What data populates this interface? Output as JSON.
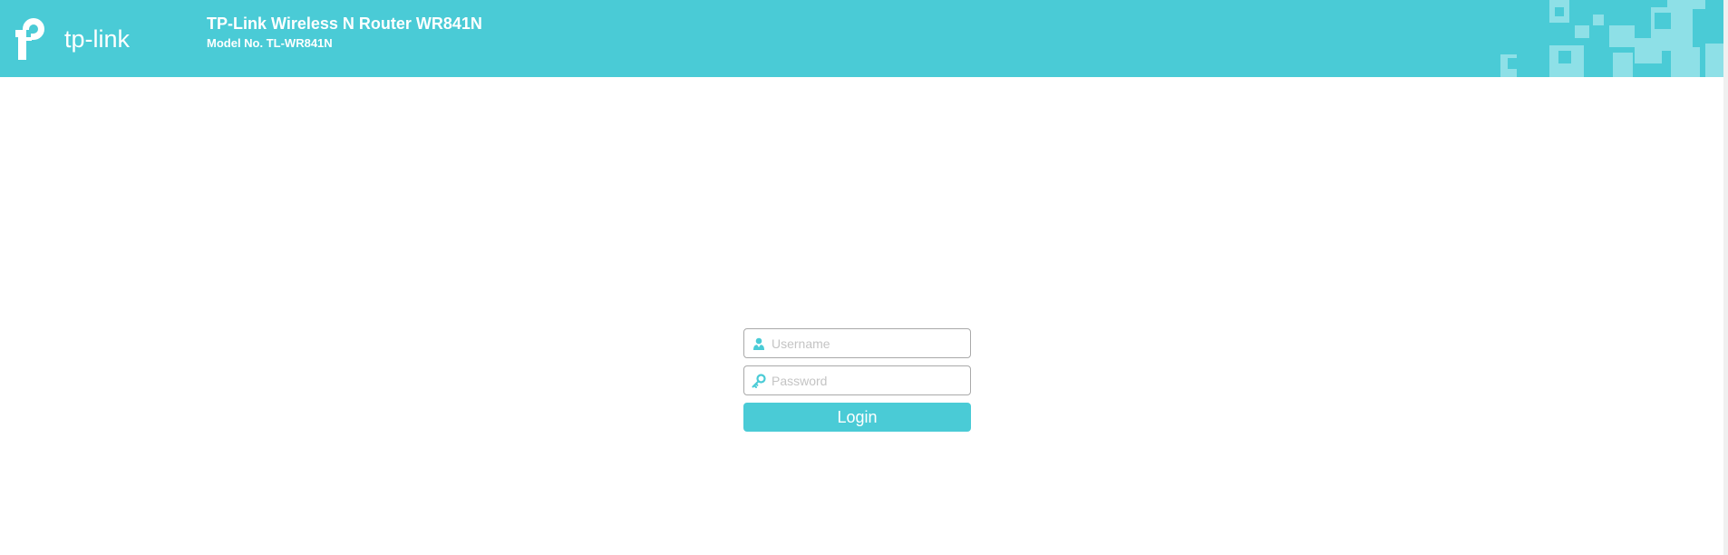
{
  "header": {
    "product_name": "TP-Link Wireless N Router WR841N",
    "model_number": "Model No. TL-WR841N",
    "logo_text": "tp-link",
    "logo_icon": "tp-link-logo-icon",
    "decoration_icon": "pixel-pattern-decoration"
  },
  "login": {
    "username_placeholder": "Username",
    "username_value": "",
    "username_icon": "user-icon",
    "password_placeholder": "Password",
    "password_value": "",
    "password_icon": "key-icon",
    "login_label": "Login"
  },
  "colors": {
    "brand_teal": "#4acbd6",
    "decor_light": "#8ee0e7",
    "text_white": "#ffffff",
    "field_border": "#a9a9a9",
    "placeholder": "#c4c4c4"
  }
}
